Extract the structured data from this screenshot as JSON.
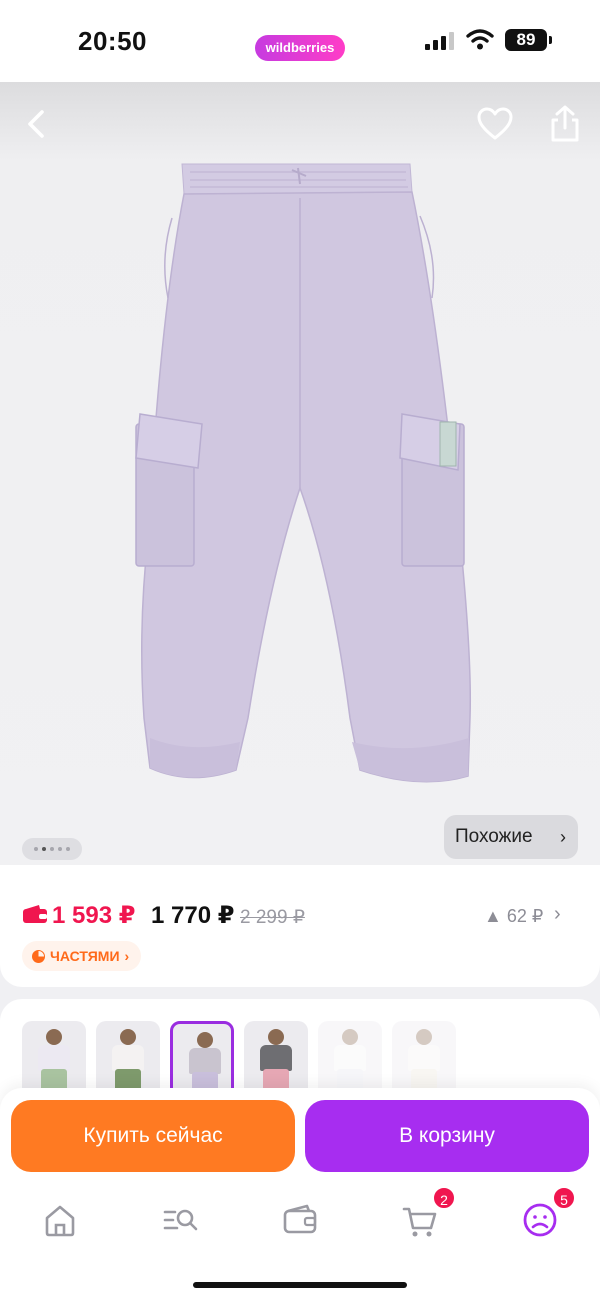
{
  "status_bar": {
    "time": "20:50",
    "brand": "wildberries",
    "battery": "89"
  },
  "hero": {
    "image_icon": "cargo-pants-image",
    "image_color": "#cfc6df",
    "back_icon": "chevron-left-icon",
    "favorite_icon": "heart-icon",
    "share_icon": "share-icon",
    "similar_label": "Похожие",
    "similar_chevron": "›",
    "gallery_dots": 5,
    "gallery_active_index": 1
  },
  "price": {
    "wallet_icon": "wallet-icon",
    "wallet_price": "1 593 ₽",
    "regular_price": "1 770 ₽",
    "old_price": "2 299 ₽",
    "price_change": "▲ 62 ₽",
    "price_change_chevron": "›",
    "installments_label": "ЧАСТЯМИ",
    "installments_chevron": "›"
  },
  "color_variants": {
    "items": [
      {
        "top": "#ece9f2",
        "legs": "#a9c3a0",
        "selected": false,
        "faded": false
      },
      {
        "top": "#f4f2f2",
        "legs": "#7e9a6c",
        "selected": false,
        "faded": false
      },
      {
        "top": "#c9c4cf",
        "legs": "#c9bfdc",
        "selected": true,
        "faded": false
      },
      {
        "top": "#6e6e72",
        "legs": "#e6a7b4",
        "selected": false,
        "faded": false
      },
      {
        "top": "#f6f6f6",
        "legs": "#e8e6f0",
        "selected": false,
        "faded": true
      },
      {
        "top": "#f4f2f2",
        "legs": "#ece7dc",
        "selected": false,
        "faded": true
      }
    ]
  },
  "actions": {
    "buy_now": "Купить сейчас",
    "add_to_cart": "В корзину",
    "buy_color": "#ff7a22",
    "cart_color": "#a72df0"
  },
  "nav": {
    "items": [
      {
        "icon": "home-icon"
      },
      {
        "icon": "catalog-search-icon"
      },
      {
        "icon": "wallet-icon"
      },
      {
        "icon": "cart-icon",
        "badge": "2"
      },
      {
        "icon": "profile-icon",
        "badge": "5"
      }
    ],
    "active_color": "#a72df0"
  }
}
